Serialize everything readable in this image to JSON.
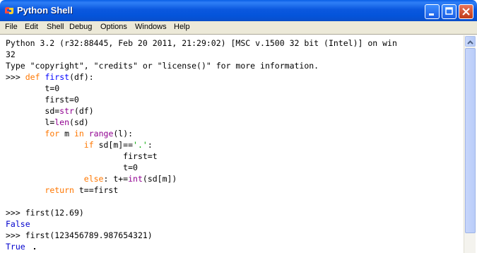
{
  "window": {
    "title": "Python Shell",
    "accent_color": "#0a5fe6"
  },
  "menubar": {
    "items": [
      "File",
      "Edit",
      "Shell",
      "Debug",
      "Options",
      "Windows",
      "Help"
    ]
  },
  "shell": {
    "banner1": "Python 3.2 (r32:88445, Feb 20 2011, 21:29:02) [MSC v.1500 32 bit (Intel)] on win",
    "banner2": "32",
    "banner3": "Type \"copyright\", \"credits\" or \"license()\" for more information.",
    "prompt": ">>>",
    "code": {
      "kw_def": "def",
      "fn_first": "first",
      "def_args": "(df):",
      "t0": "t=0",
      "first0": "first=0",
      "sd_pre": "sd=",
      "bi_str": "str",
      "sd_post": "(df)",
      "l_pre": "l=",
      "bi_len": "len",
      "l_post": "(sd)",
      "kw_for": "for",
      "for_m": " m ",
      "kw_in": "in",
      "bi_range": "range",
      "range_post": "(l):",
      "kw_if": "if",
      "if_pre": " sd[m]==",
      "str_dot": "'.'",
      "if_post": ":",
      "first_t": "first=t",
      "t0_inner": "t=0",
      "kw_else": "else",
      "else_mid": ": t+=",
      "bi_int": "int",
      "else_post": "(sd[m])",
      "kw_return": "return",
      "return_post": " t==first"
    },
    "call1": "first(12.69)",
    "result1": "False",
    "call2": "first(123456789.987654321)",
    "result2": "True"
  },
  "syntax_colors": {
    "keyword": "#ff7700",
    "definition": "#0000ff",
    "builtin": "#900090",
    "string": "#00aa00",
    "output": "#0000cc"
  }
}
